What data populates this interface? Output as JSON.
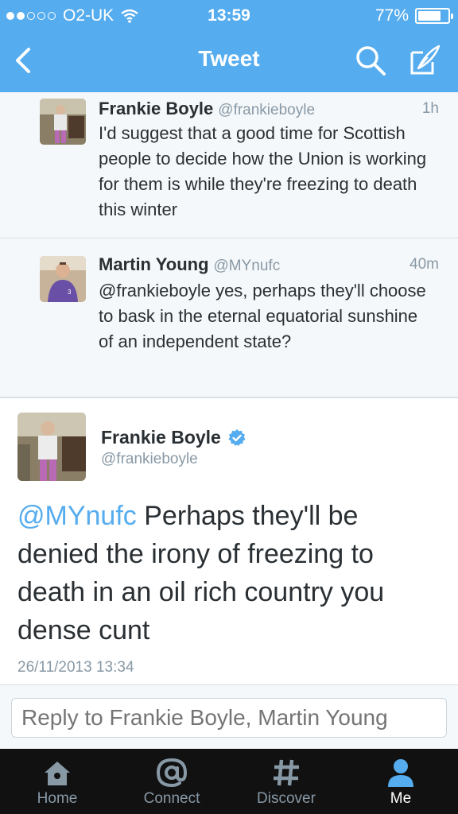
{
  "status_bar": {
    "carrier": "O2-UK",
    "time": "13:59",
    "battery": "77%",
    "battery_level": 0.77,
    "signal_dots_filled": 2,
    "signal_dots_total": 5,
    "wifi_icon": "wifi-icon"
  },
  "nav": {
    "title": "Tweet",
    "back_icon": "chevron-left-icon",
    "search_icon": "search-icon",
    "compose_icon": "compose-icon"
  },
  "replies": [
    {
      "name": "Frankie Boyle",
      "handle": "@frankieboyle",
      "age": "1h",
      "text": "I'd suggest that a good time for Scottish people to decide how the Union is working for them is while they're freezing to death this winter"
    },
    {
      "name": "Martin Young",
      "handle": "@MYnufc",
      "age": "40m",
      "text": "@frankieboyle yes, perhaps they'll choose to bask in the eternal equatorial sunshine of an independent state?"
    }
  ],
  "main_tweet": {
    "name": "Frankie Boyle",
    "handle": "@frankieboyle",
    "mention": "@MYnufc",
    "text": " Perhaps they'll be denied the irony of freezing to death in an oil rich country you dense cunt",
    "timestamp": "26/11/2013 13:34",
    "verified": true
  },
  "reply_box": {
    "placeholder": "Reply to Frankie Boyle, Martin Young"
  },
  "tabbar": [
    {
      "label": "Home",
      "icon": "home-icon",
      "active": false
    },
    {
      "label": "Connect",
      "icon": "at-sign-icon",
      "active": false
    },
    {
      "label": "Discover",
      "icon": "hashtag-icon",
      "active": false
    },
    {
      "label": "Me",
      "icon": "person-icon",
      "active": true
    }
  ],
  "colors": {
    "brand": "#55acee",
    "text": "#292f33",
    "muted": "#8899a6",
    "tabbar_bg": "#111111"
  }
}
